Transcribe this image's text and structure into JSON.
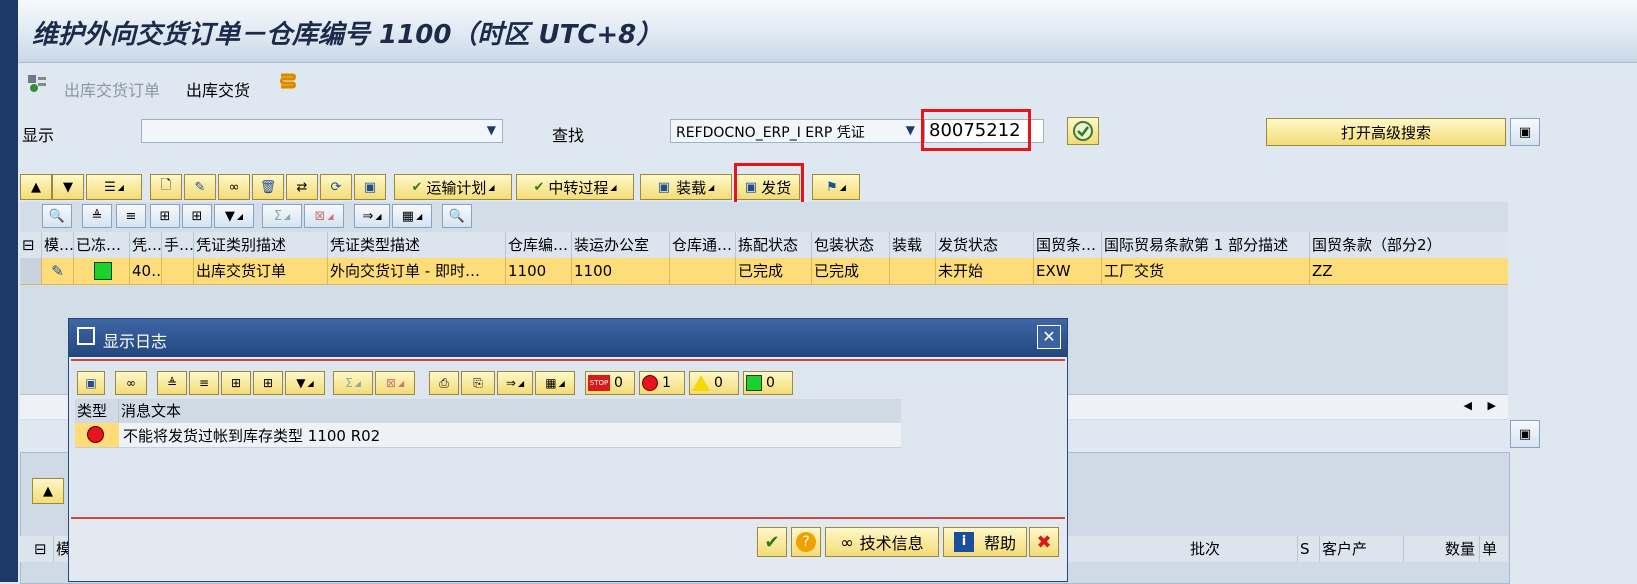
{
  "window": {
    "title": "维护外向交货订单－仓库编号 1100（时区 UTC+8）"
  },
  "appbar": {
    "item1": "出库交货订单",
    "item2": "出库交货"
  },
  "search_row": {
    "display_label": "显示",
    "display_value": "",
    "find_label": "查找",
    "find_field": "REFDOCNO_ERP_I ERP 凭证",
    "find_value": "80075212",
    "advanced_search": "打开高级搜索"
  },
  "toolbar": {
    "transport_plan": "运输计划",
    "transfer_process": "中转过程",
    "loading": "装载",
    "goods_issue": "发货"
  },
  "table": {
    "headers": [
      "模…",
      "已冻…",
      "凭…",
      "手…",
      "凭证类别描述",
      "凭证类型描述",
      "仓库编…",
      "装运办公室",
      "仓库通…",
      "拣配状态",
      "包装状态",
      "装载",
      "发货状态",
      "国贸条…",
      "国际贸易条款第 1 部分描述",
      "国贸条款（部分2）"
    ],
    "row": {
      "doc_no": "40…",
      "manual": "",
      "category": "出库交货订单",
      "type": "外向交货订单 - 即时…",
      "warehouse": "1100",
      "shipping_office": "1100",
      "door": "",
      "picking": "已完成",
      "packing": "已完成",
      "loading": "",
      "gi_status": "未开始",
      "incoterm": "EXW",
      "incoterm_desc": "工厂交货",
      "incoterm2": "ZZ"
    }
  },
  "lower_table": {
    "batch": "批次",
    "s": "S",
    "customer": "客户产",
    "qty": "数量",
    "unit": "单",
    "first_col": "模"
  },
  "dialog": {
    "title": "显示日志",
    "counts": {
      "stop": "0",
      "error": "1",
      "warning": "0",
      "success": "0"
    },
    "col_type": "类型",
    "col_text": "消息文本",
    "message": "不能将发货过帐到库存类型 1100 R02",
    "tech_info": "技术信息",
    "help": "帮助"
  },
  "colors": {
    "highlight_row": "#ffdc7a",
    "error": "#e8141c",
    "title_bar": "#2c4f8a"
  }
}
